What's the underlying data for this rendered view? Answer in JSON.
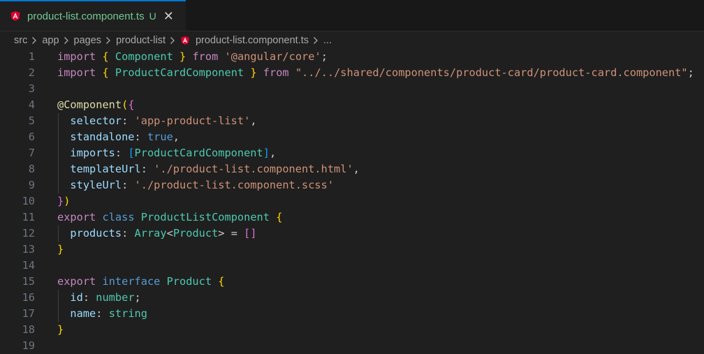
{
  "tab": {
    "title": "product-list.component.ts",
    "status": "U",
    "close": "✕",
    "icon": "angular-icon"
  },
  "breadcrumb": [
    "src",
    "app",
    "pages",
    "product-list",
    "product-list.component.ts",
    "..."
  ],
  "colors": {
    "accent": "#0078d4",
    "untracked": "#73c991",
    "angular": "#dd0031"
  },
  "lines": [
    [
      [
        "import",
        "kw-purple"
      ],
      [
        " ",
        "plain"
      ],
      [
        "{",
        "b1"
      ],
      [
        " ",
        "plain"
      ],
      [
        "Component",
        "type"
      ],
      [
        " ",
        "plain"
      ],
      [
        "}",
        "b1"
      ],
      [
        " ",
        "plain"
      ],
      [
        "from",
        "kw-purple"
      ],
      [
        " ",
        "plain"
      ],
      [
        "'@angular/core'",
        "str"
      ],
      [
        ";",
        "plain"
      ]
    ],
    [
      [
        "import",
        "kw-purple"
      ],
      [
        " ",
        "plain"
      ],
      [
        "{",
        "b1"
      ],
      [
        " ",
        "plain"
      ],
      [
        "ProductCardComponent",
        "type"
      ],
      [
        " ",
        "plain"
      ],
      [
        "}",
        "b1"
      ],
      [
        " ",
        "plain"
      ],
      [
        "from",
        "kw-purple"
      ],
      [
        " ",
        "plain"
      ],
      [
        "\"../../shared/components/product-card/product-card.component\"",
        "str"
      ],
      [
        ";",
        "plain"
      ]
    ],
    [],
    [
      [
        "@Component",
        "dec"
      ],
      [
        "(",
        "b1"
      ],
      [
        "{",
        "b2"
      ]
    ],
    [
      [
        "  ",
        "plain"
      ],
      [
        "selector",
        "prop"
      ],
      [
        ": ",
        "plain"
      ],
      [
        "'app-product-list'",
        "str"
      ],
      [
        ",",
        "plain"
      ]
    ],
    [
      [
        "  ",
        "plain"
      ],
      [
        "standalone",
        "prop"
      ],
      [
        ": ",
        "plain"
      ],
      [
        "true",
        "kw-blue"
      ],
      [
        ",",
        "plain"
      ]
    ],
    [
      [
        "  ",
        "plain"
      ],
      [
        "imports",
        "prop"
      ],
      [
        ": ",
        "plain"
      ],
      [
        "[",
        "b3"
      ],
      [
        "ProductCardComponent",
        "type"
      ],
      [
        "]",
        "b3"
      ],
      [
        ",",
        "plain"
      ]
    ],
    [
      [
        "  ",
        "plain"
      ],
      [
        "templateUrl",
        "prop"
      ],
      [
        ": ",
        "plain"
      ],
      [
        "'./product-list.component.html'",
        "str"
      ],
      [
        ",",
        "plain"
      ]
    ],
    [
      [
        "  ",
        "plain"
      ],
      [
        "styleUrl",
        "prop"
      ],
      [
        ": ",
        "plain"
      ],
      [
        "'./product-list.component.scss'",
        "str"
      ]
    ],
    [
      [
        "}",
        "b2"
      ],
      [
        ")",
        "b1"
      ]
    ],
    [
      [
        "export",
        "kw-purple"
      ],
      [
        " ",
        "plain"
      ],
      [
        "class",
        "kw-blue"
      ],
      [
        " ",
        "plain"
      ],
      [
        "ProductListComponent",
        "type"
      ],
      [
        " ",
        "plain"
      ],
      [
        "{",
        "b1"
      ]
    ],
    [
      [
        "  ",
        "plain"
      ],
      [
        "products",
        "prop"
      ],
      [
        ": ",
        "plain"
      ],
      [
        "Array",
        "type"
      ],
      [
        "<",
        "plain"
      ],
      [
        "Product",
        "type"
      ],
      [
        ">",
        "plain"
      ],
      [
        " = ",
        "plain"
      ],
      [
        "[]",
        "b2"
      ]
    ],
    [
      [
        "}",
        "b1"
      ]
    ],
    [],
    [
      [
        "export",
        "kw-purple"
      ],
      [
        " ",
        "plain"
      ],
      [
        "interface",
        "kw-blue"
      ],
      [
        " ",
        "plain"
      ],
      [
        "Product",
        "type"
      ],
      [
        " ",
        "plain"
      ],
      [
        "{",
        "b1"
      ]
    ],
    [
      [
        "  ",
        "plain"
      ],
      [
        "id",
        "prop"
      ],
      [
        ": ",
        "plain"
      ],
      [
        "number",
        "type"
      ],
      [
        ";",
        "plain"
      ]
    ],
    [
      [
        "  ",
        "plain"
      ],
      [
        "name",
        "prop"
      ],
      [
        ": ",
        "plain"
      ],
      [
        "string",
        "type"
      ]
    ],
    [
      [
        "}",
        "b1"
      ]
    ],
    []
  ]
}
